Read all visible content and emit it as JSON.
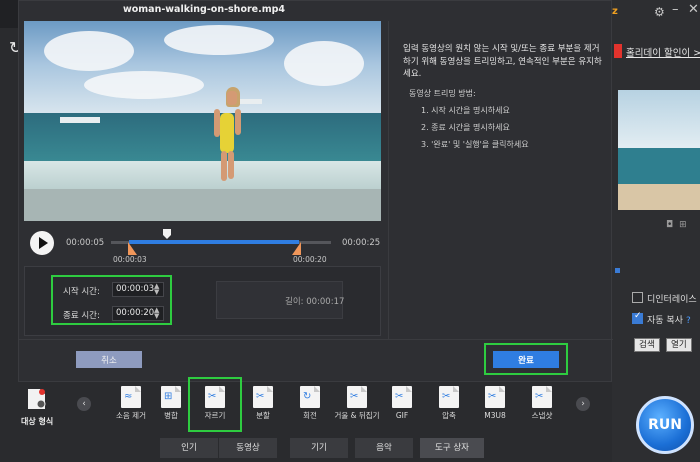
{
  "dialog": {
    "title": "woman-walking-on-shore.mp4"
  },
  "player": {
    "current_time": "00:00:05",
    "total_time": "00:00:25",
    "start_marker": "00:00:03",
    "end_marker": "00:00:20"
  },
  "trim": {
    "start_label": "시작 시간:",
    "start_value": "00:00:03",
    "end_label": "종료 시간:",
    "end_value": "00:00:20",
    "length_label": "길이:",
    "length_value": "00:00:17"
  },
  "instructions": {
    "intro": "입력 동영상의 원치 않는 시작 및/또는 종료 부분을 제거하기 위해 동영상을 트리밍하고, 연속적인 부분은 유지하세요.",
    "method_title": "동영상 트리밍 방법:",
    "steps": [
      "1. 시작 시간을 명시하세요",
      "2. 종료 시간을 명시하세요",
      "3. '완료' 및 '실행'을 클릭하세요"
    ]
  },
  "buttons": {
    "cancel": "취소",
    "done": "완료",
    "run": "RUN"
  },
  "background": {
    "promo_link": "홀리데이 할인이 >",
    "deinterlace_label": "디인터레이스",
    "auto_copy_label": "자동 복사",
    "help": "?",
    "browse": "검색",
    "open": "열기",
    "target_format": "대상 형식"
  },
  "tools": [
    {
      "label": "소음 제거",
      "icon": "noise-removal-icon",
      "glyph": "≈"
    },
    {
      "label": "병합",
      "icon": "merge-icon",
      "glyph": "⊞"
    },
    {
      "label": "자르기",
      "icon": "trim-icon",
      "glyph": "✂"
    },
    {
      "label": "분할",
      "icon": "split-icon",
      "glyph": "✂"
    },
    {
      "label": "회전",
      "icon": "rotate-icon",
      "glyph": "↻"
    },
    {
      "label": "거울 & 뒤집기",
      "icon": "mirror-flip-icon",
      "glyph": "✂"
    },
    {
      "label": "GIF",
      "icon": "gif-icon",
      "glyph": "✂"
    },
    {
      "label": "압축",
      "icon": "compress-icon",
      "glyph": "✂"
    },
    {
      "label": "M3U8",
      "icon": "m3u8-icon",
      "glyph": "✂"
    },
    {
      "label": "스냅샷",
      "icon": "snapshot-icon",
      "glyph": "✂"
    }
  ],
  "tabs": [
    "인기",
    "동영상",
    "기기",
    "음악",
    "도구 상자"
  ],
  "colors": {
    "accent": "#2f7de1",
    "highlight": "#2ecc40",
    "trim_handle": "#f0965a"
  }
}
